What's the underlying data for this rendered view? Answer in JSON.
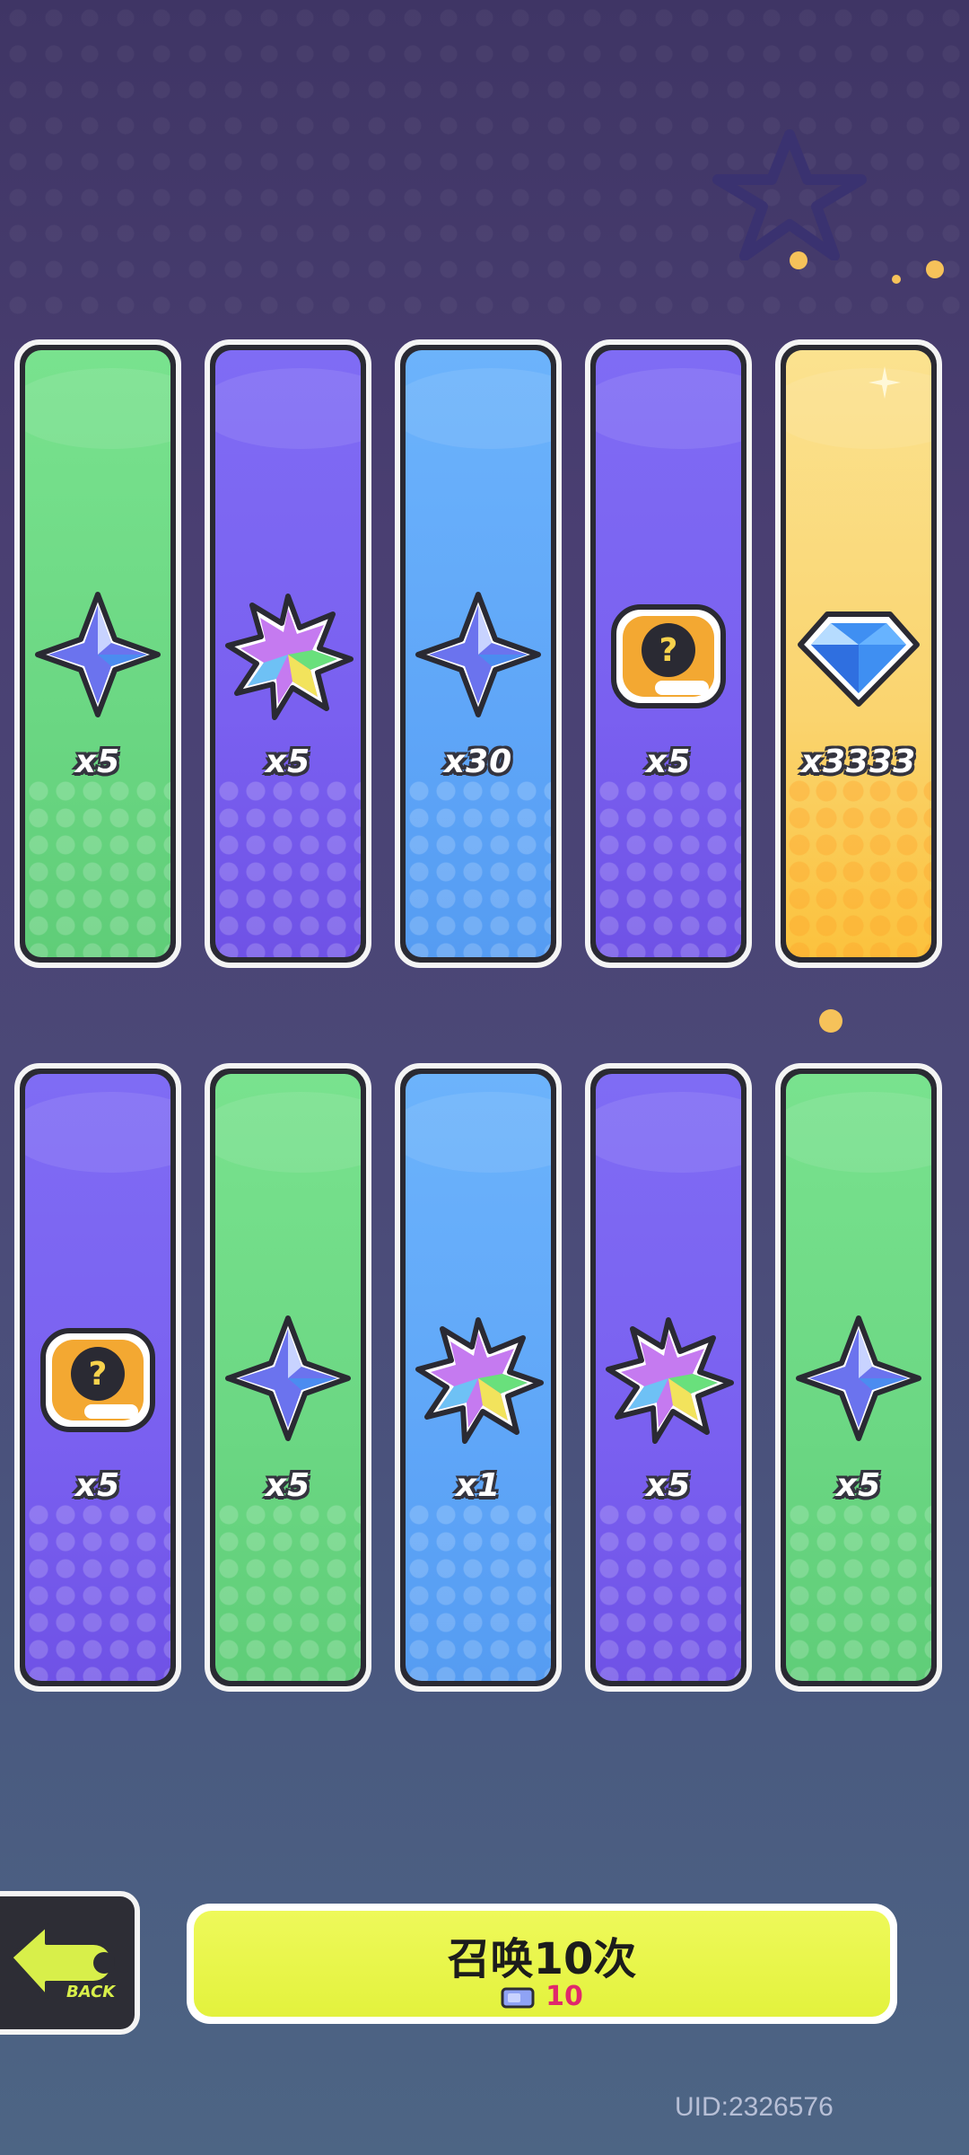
{
  "rows": [
    [
      {
        "bg": "green",
        "icon": "blue-star-icon",
        "qty": "x5"
      },
      {
        "bg": "purple",
        "icon": "rainbow-leaf-icon",
        "qty": "x5"
      },
      {
        "bg": "blue",
        "icon": "blue-star-icon",
        "qty": "x30"
      },
      {
        "bg": "purple",
        "icon": "mystery-badge-icon",
        "qty": "x5"
      },
      {
        "bg": "gold",
        "icon": "diamond-icon",
        "qty": "x3333"
      }
    ],
    [
      {
        "bg": "purple",
        "icon": "mystery-badge-icon",
        "qty": "x5"
      },
      {
        "bg": "green",
        "icon": "blue-star-icon",
        "qty": "x5"
      },
      {
        "bg": "blue",
        "icon": "rainbow-leaf-icon",
        "qty": "x1"
      },
      {
        "bg": "purple",
        "icon": "rainbow-leaf-icon",
        "qty": "x5"
      },
      {
        "bg": "green",
        "icon": "blue-star-icon",
        "qty": "x5"
      }
    ]
  ],
  "back_button": {
    "label": "BACK",
    "icon": "back-arrow-icon"
  },
  "summon_button": {
    "title": "召唤10次",
    "cost": "10",
    "cost_icon": "ticket-icon"
  },
  "uid": "UID:2326576",
  "colors": {
    "green": "#6bd783",
    "purple": "#7a60f0",
    "blue": "#5fa6f8",
    "gold": "#fad46f",
    "summon": "#e3f23d",
    "cost": "#e0286c"
  }
}
